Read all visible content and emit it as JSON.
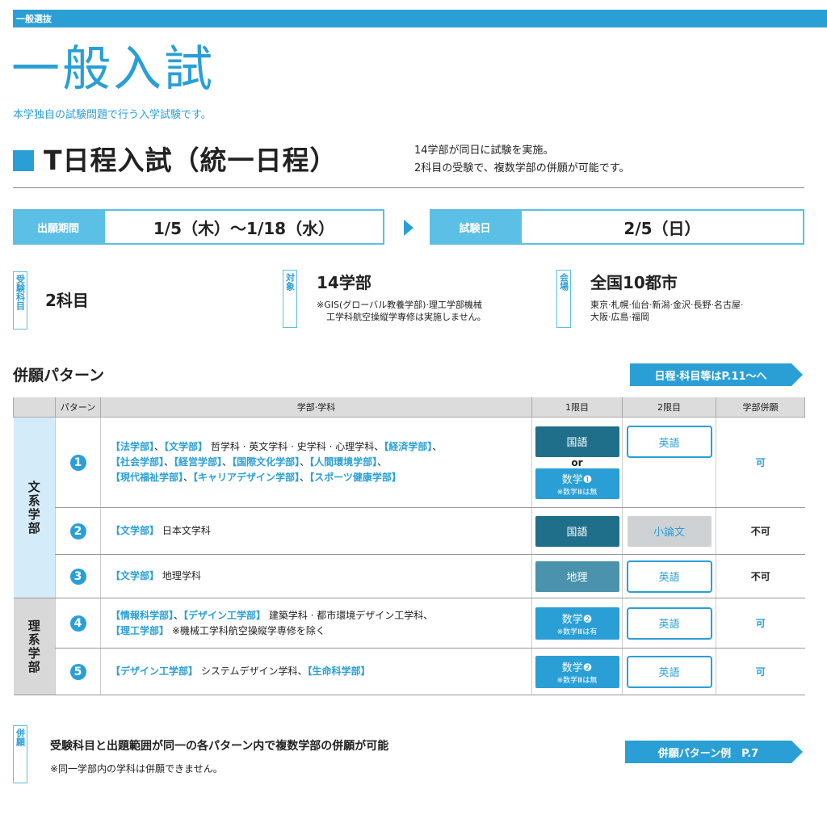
{
  "header": {
    "section_tag": "一般選抜",
    "title": "一般入試",
    "subtitle": "本学独自の試験問題で行う入学試験です。"
  },
  "schedule_title": "T日程入試（統一日程）",
  "schedule_note": [
    "14学部が同日に試験を実施。",
    "2科目の受験で、複数学部の併願が可能です。"
  ],
  "application": {
    "label": "出願期間",
    "value": "1/5（木）〜1/18（水）"
  },
  "exam": {
    "label": "試験日",
    "value": "2/5（日）"
  },
  "subjects": {
    "tag": "受験科目",
    "value": "2科目"
  },
  "target": {
    "tag": "対象",
    "value": "14学部",
    "note": [
      "※GIS(グローバル教養学部)·理工学部機械",
      "工学科航空操縦学専修は実施しません。"
    ]
  },
  "venue": {
    "tag": "会場",
    "value": "全国10都市",
    "note": [
      "東京·札幌·仙台·新潟·金沢·長野·名古屋·",
      "大阪·広島·福岡"
    ]
  },
  "pattern_title": "併願パターン",
  "pattern_link": "日程·科目等はP.11〜へ",
  "table": {
    "headers": [
      "",
      "パターン",
      "学部·学科",
      "1限目",
      "2限目",
      "学部併願"
    ],
    "groups": [
      "文系学部",
      "理系学部"
    ],
    "rows": [
      {
        "num": "1",
        "lines": [
          [
            [
              "b",
              "【法学部】"
            ],
            [
              "n",
              "、"
            ],
            [
              "b",
              "【文学部】"
            ],
            [
              "n",
              " 哲学科 · 英文学科 · 史学科 · 心理学科、"
            ],
            [
              "b",
              "【経済学部】"
            ],
            [
              "n",
              "、"
            ]
          ],
          [
            [
              "b",
              "【社会学部】"
            ],
            [
              "n",
              "、"
            ],
            [
              "b",
              "【経営学部】"
            ],
            [
              "n",
              "、"
            ],
            [
              "b",
              "【国際文化学部】"
            ],
            [
              "n",
              "、"
            ],
            [
              "b",
              "【人間環境学部】"
            ],
            [
              "n",
              "、"
            ]
          ],
          [
            [
              "b",
              "【現代福祉学部】"
            ],
            [
              "n",
              "、"
            ],
            [
              "b",
              "【キャリアデザイン学部】"
            ],
            [
              "n",
              "、"
            ],
            [
              "b",
              "【スポーツ健康学部】"
            ]
          ]
        ],
        "p1": "国語",
        "or": "or",
        "p1b": "数学❶",
        "p1b_note": "※数学Ⅲは無",
        "p2": "英語",
        "result": "可"
      },
      {
        "num": "2",
        "lines": [
          [
            [
              "b",
              "【文学部】"
            ],
            [
              "n",
              " 日本文学科"
            ]
          ]
        ],
        "p1": "国語",
        "p2": "小論文",
        "result": "不可"
      },
      {
        "num": "3",
        "lines": [
          [
            [
              "b",
              "【文学部】"
            ],
            [
              "n",
              " 地理学科"
            ]
          ]
        ],
        "p1": "地理",
        "p2": "英語",
        "result": "不可"
      },
      {
        "num": "4",
        "lines": [
          [
            [
              "b",
              "【情報科学部】"
            ],
            [
              "n",
              "、"
            ],
            [
              "b",
              "【デザイン工学部】"
            ],
            [
              "n",
              " 建築学科 · 都市環境デザイン工学科、"
            ]
          ],
          [
            [
              "b",
              "【理工学部】"
            ],
            [
              "n",
              " ※機械工学科航空操縦学専修を除く"
            ]
          ]
        ],
        "p1": "数学❷",
        "p1_note": "※数学Ⅲは有",
        "p2": "英語",
        "result": "可"
      },
      {
        "num": "5",
        "lines": [
          [
            [
              "b",
              "【デザイン工学部】"
            ],
            [
              "n",
              " システムデザイン学科、"
            ],
            [
              "b",
              "【生命科学部】"
            ]
          ]
        ],
        "p1": "数学❷",
        "p1_note": "※数学Ⅲは無",
        "p2": "英語",
        "result": "可"
      }
    ]
  },
  "footer": {
    "tag": "併願",
    "text": "受験科目と出題範囲が同一の各パターン内で複数学部の併願が可能",
    "note": "※同一学部内の学科は併願できません。",
    "link": "併願パターン例　P.7"
  },
  "colors": {
    "accent": "#2a9fd6",
    "light": "#5bbfe6",
    "dark_chip": "#1f6f8b",
    "mid_chip": "#4b93ad",
    "gray_chip": "#cfd2d4",
    "bunkei_bg": "#d4ecfa",
    "rikei_bg": "#d8d8d8"
  }
}
